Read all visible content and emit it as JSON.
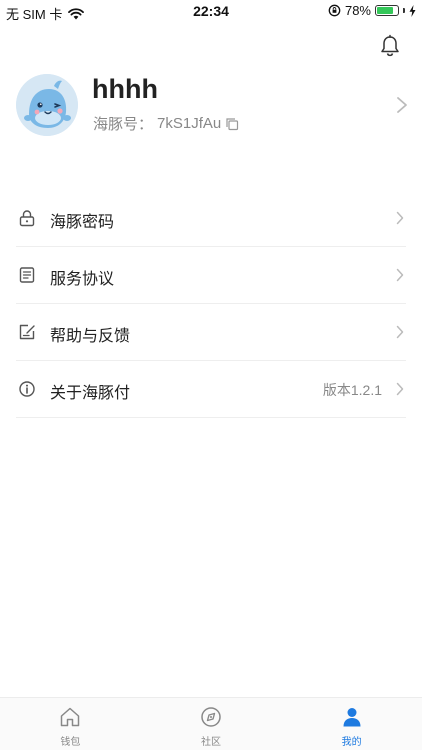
{
  "status_bar": {
    "carrier": "无 SIM 卡",
    "time": "22:34",
    "battery_percent": "78%",
    "battery_level": 0.78
  },
  "profile": {
    "username": "hhhh",
    "id_label": "海豚号：",
    "id_value": "7kS1JfAu"
  },
  "menu": {
    "items": [
      {
        "label": "海豚密码",
        "icon": "lock-icon",
        "value": ""
      },
      {
        "label": "服务协议",
        "icon": "document-icon",
        "value": ""
      },
      {
        "label": "帮助与反馈",
        "icon": "feedback-icon",
        "value": ""
      },
      {
        "label": "关于海豚付",
        "icon": "info-icon",
        "value": "版本1.2.1"
      }
    ]
  },
  "tab_bar": {
    "tabs": [
      {
        "label": "钱包",
        "icon": "home-icon",
        "active": false
      },
      {
        "label": "社区",
        "icon": "community-icon",
        "active": false
      },
      {
        "label": "我的",
        "icon": "person-icon",
        "active": true
      }
    ],
    "active_color": "#1e7ae0",
    "inactive_color": "#888888"
  }
}
